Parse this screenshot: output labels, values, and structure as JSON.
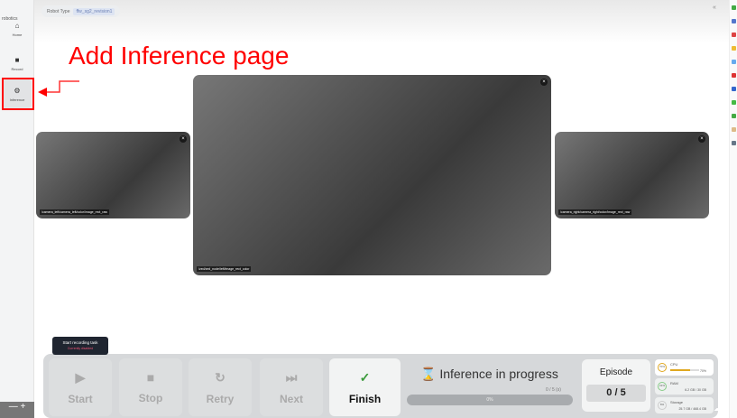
{
  "sidebar": {
    "logo": "robotics",
    "items": [
      {
        "label": "Home",
        "icon": "home-icon"
      },
      {
        "label": "Record",
        "icon": "video-icon"
      },
      {
        "label": "Inference",
        "icon": "gear-icon"
      }
    ]
  },
  "header": {
    "robot_type_label": "Robot Type",
    "robot_type_value": "ffw_sg2_revision1"
  },
  "annotation": {
    "text": "Add Inference page",
    "color": "#ff0000"
  },
  "cameras": [
    {
      "topic": "/camera_left/camera_left/color/image_rect_raw"
    },
    {
      "topic": "/zed/zed_node/left/image_rect_color"
    },
    {
      "topic": "/camera_right/camera_right/color/image_rect_raw"
    }
  ],
  "controls": {
    "start": "Start",
    "stop": "Stop",
    "retry": "Retry",
    "next": "Next",
    "finish": "Finish"
  },
  "tooltip": {
    "title": "Start recording task",
    "subtitle": "Currently disabled"
  },
  "status": {
    "icon": "hourglass-icon",
    "text": "Inference in progress",
    "time": "0 / 5 (s)",
    "progress_label": "0%",
    "progress": 0
  },
  "episode": {
    "label": "Episode",
    "value": "0 / 5"
  },
  "system": {
    "cpu": {
      "label": "CPU",
      "percent": "70%",
      "value": "70%",
      "fraction": 0.7
    },
    "ram": {
      "label": "RAM",
      "percent": "21%",
      "value": "6.2 GB / 30 GB"
    },
    "storage": {
      "label": "Storage",
      "percent": "6%",
      "value": "25.7 GB / 468.4 GB"
    }
  }
}
